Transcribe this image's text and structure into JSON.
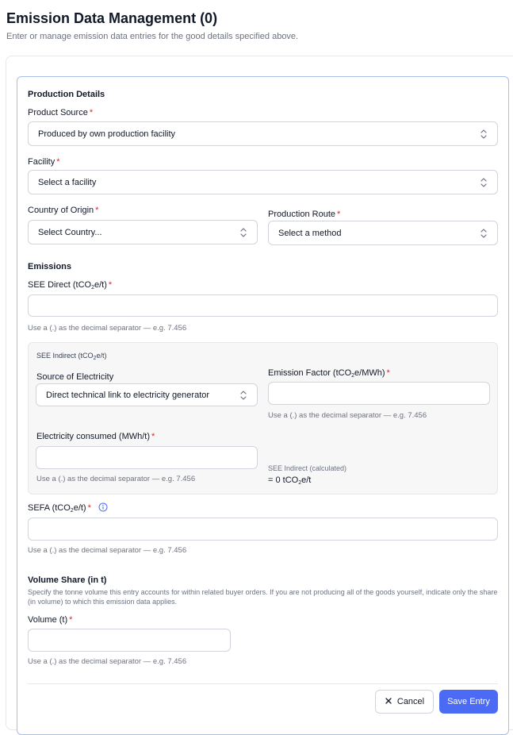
{
  "header": {
    "title": "Emission Data Management (0)",
    "subtitle": "Enter or manage emission data entries for the good details specified above."
  },
  "production": {
    "section_title": "Production Details",
    "product_source": {
      "label": "Product Source",
      "value": "Produced by own production facility"
    },
    "facility": {
      "label": "Facility",
      "value": "Select a facility"
    },
    "country": {
      "label": "Country of Origin",
      "value": "Select Country..."
    },
    "route": {
      "label": "Production Route",
      "value": "Select a method"
    }
  },
  "emissions": {
    "section_title": "Emissions",
    "see_direct": {
      "label_pre": "SEE Direct (tCO",
      "label_sub": "2",
      "label_post": "e/t)",
      "value": "",
      "hint": "Use a (.) as the decimal separator — e.g. 7.456"
    },
    "see_indirect": {
      "box_label_pre": "SEE Indirect (tCO",
      "box_label_sub": "2",
      "box_label_post": "e/t)",
      "source": {
        "label": "Source of Electricity",
        "value": "Direct technical link to electricity generator"
      },
      "factor": {
        "label_pre": "Emission Factor (tCO",
        "label_sub": "2",
        "label_post": "e/MWh)",
        "value": "",
        "hint": "Use a (.) as the decimal separator — e.g. 7.456"
      },
      "consumed": {
        "label": "Electricity consumed (MWh/t)",
        "value": "",
        "hint": "Use a (.) as the decimal separator — e.g. 7.456"
      },
      "calculated": {
        "label": "SEE Indirect (calculated)",
        "value_pre": "= 0 tCO",
        "value_sub": "2",
        "value_post": "e/t"
      }
    },
    "sefa": {
      "label_pre": "SEFA (tCO",
      "label_sub": "2",
      "label_post": "e/t)",
      "value": "",
      "hint": "Use a (.) as the decimal separator — e.g. 7.456"
    }
  },
  "volume": {
    "section_title": "Volume Share (in t)",
    "description": "Specify the tonne volume this entry accounts for within related buyer orders. If you are not producing all of the goods yourself, indicate only the share (in volume) to which this emission data applies.",
    "field": {
      "label": "Volume (t)",
      "value": "",
      "hint": "Use a (.) as the decimal separator — e.g. 7.456"
    }
  },
  "required_marker": "*",
  "footer": {
    "cancel_label": "Cancel",
    "save_label": "Save Entry"
  },
  "colors": {
    "accent": "#4b6bf5",
    "required": "#dc2626",
    "border_focus": "#a8bde8"
  },
  "icons": {
    "select": "chevron-up-down-icon",
    "info": "info-icon",
    "cancel": "close-icon"
  }
}
